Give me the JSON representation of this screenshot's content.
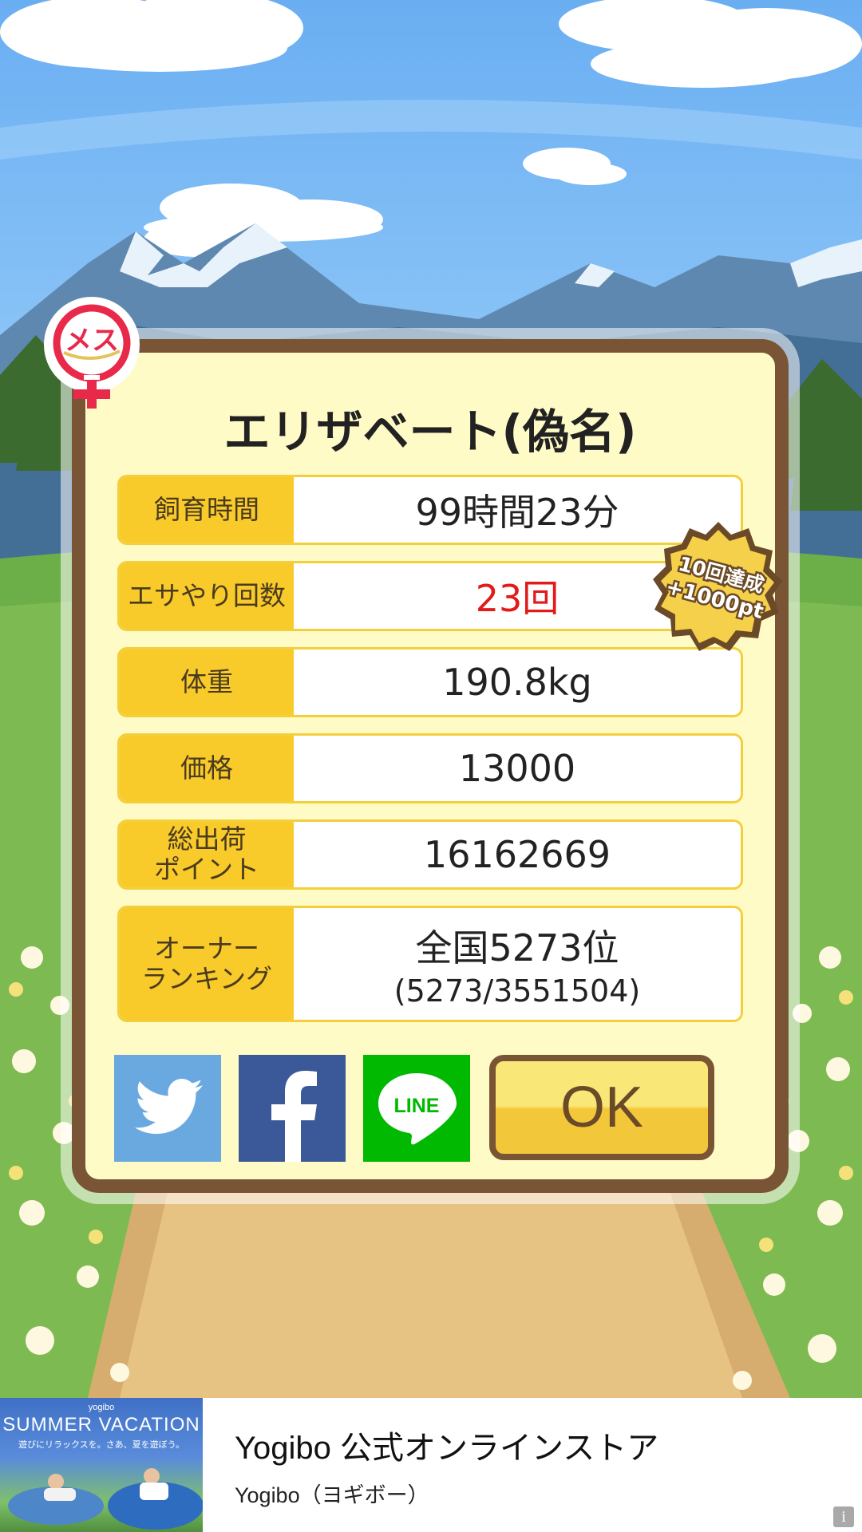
{
  "pet": {
    "name": "エリザベート(偽名)",
    "gender_label": "メス"
  },
  "stats": [
    {
      "label": "飼育時間",
      "value": "99時間23分",
      "color": "#222222"
    },
    {
      "label": "エサやり回数",
      "value": "23回",
      "color": "#e21a1a"
    },
    {
      "label": "体重",
      "value": "190.8kg",
      "color": "#222222"
    },
    {
      "label": "価格",
      "value": "13000",
      "color": "#222222"
    },
    {
      "label": "総出荷\nポイント",
      "value": "16162669",
      "color": "#222222"
    },
    {
      "label": "オーナー\nランキング",
      "value": "全国5273位",
      "sub": "(5273/3551504)",
      "color": "#222222"
    }
  ],
  "badge": {
    "line1": "10回達成",
    "line2": "+1000pt"
  },
  "share": {
    "twitter": {
      "icon": "twitter-bird-icon",
      "color": "#6aa9e0"
    },
    "facebook": {
      "icon": "facebook-f-icon",
      "color": "#3b5998"
    },
    "line": {
      "icon": "line-bubble-icon",
      "label": "LINE",
      "color": "#00b900"
    }
  },
  "ok_button": {
    "label": "OK"
  },
  "ad": {
    "image_brand": "yogibo",
    "image_headline": "SUMMER VACATION",
    "image_tagline": "遊びにリラックスを。さあ、夏を遊ぼう。",
    "title": "Yogibo 公式オンラインストア",
    "subtitle": "Yogibo（ヨギボー）",
    "info_icon": "i"
  },
  "colors": {
    "panel_bg": "#fffbc7",
    "panel_border": "#7a5535",
    "label_bg": "#f8ca2a",
    "row_border": "#f4cf3c"
  }
}
